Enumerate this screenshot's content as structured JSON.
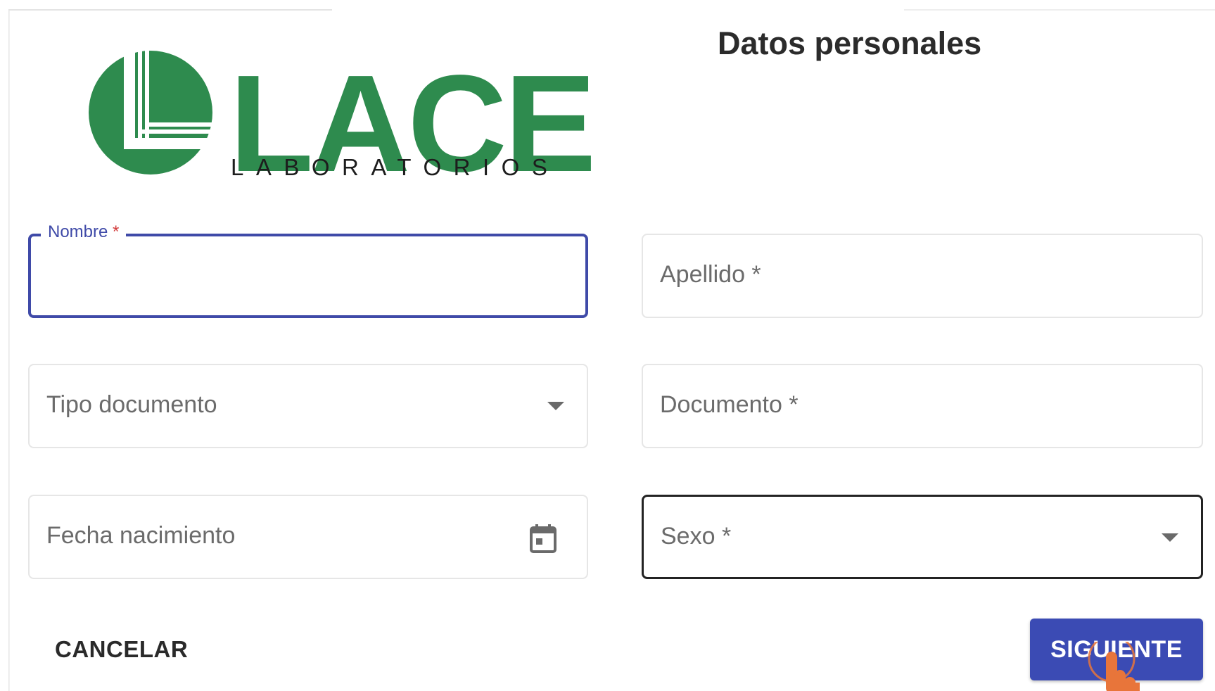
{
  "logo": {
    "letters": "LACE",
    "subtitle": "LABORATORIOS",
    "brand_color": "#2e8b4e"
  },
  "form": {
    "title": "Datos personales",
    "fields": {
      "nombre": {
        "label": "Nombre",
        "required_mark": "*",
        "value": ""
      },
      "apellido": {
        "label": "Apellido *",
        "value": ""
      },
      "tipo_documento": {
        "label": "Tipo documento",
        "icon": "chevron-down-icon"
      },
      "documento": {
        "label": "Documento *",
        "value": ""
      },
      "fecha_nacimiento": {
        "label": "Fecha nacimiento",
        "icon": "calendar-icon"
      },
      "sexo": {
        "label": "Sexo *",
        "icon": "chevron-down-icon"
      }
    },
    "actions": {
      "cancel_label": "CANCELAR",
      "next_label": "SIGUIENTE"
    }
  },
  "colors": {
    "accent": "#3f4aa8",
    "primary_button": "#3b4bb4",
    "required": "#d23c3c",
    "cursor": "#e8753a"
  }
}
